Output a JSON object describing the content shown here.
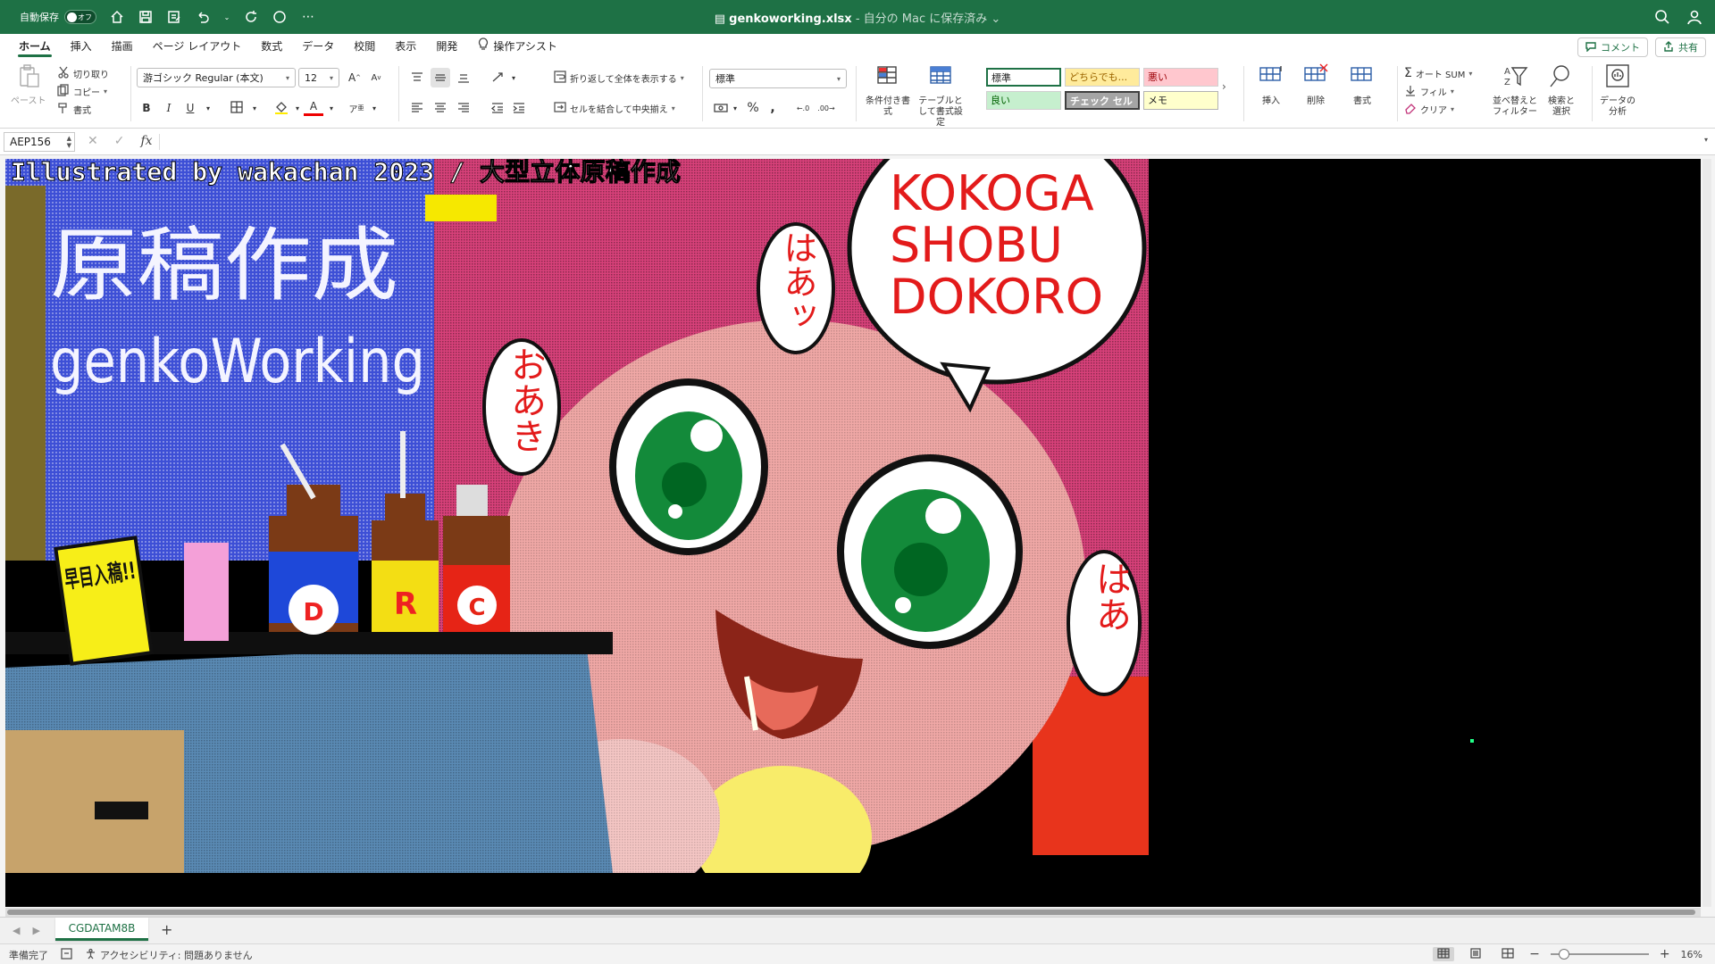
{
  "titlebar": {
    "autosave_label": "自動保存",
    "autosave_state": "オフ",
    "filename": "genkoworking.xlsx",
    "location": "- 自分の Mac に保存済み",
    "bg_color": "#1e7145"
  },
  "tabs": [
    {
      "label": "ホーム",
      "active": true
    },
    {
      "label": "挿入"
    },
    {
      "label": "描画"
    },
    {
      "label": "ページ レイアウト"
    },
    {
      "label": "数式"
    },
    {
      "label": "データ"
    },
    {
      "label": "校閲"
    },
    {
      "label": "表示"
    },
    {
      "label": "開発"
    },
    {
      "label": "操作アシスト"
    }
  ],
  "share": {
    "comment_label": "コメント",
    "share_label": "共有"
  },
  "clipboard": {
    "paste_label": "ペースト",
    "cut_label": "切り取り",
    "copy_label": "コピー",
    "format_label": "書式"
  },
  "font": {
    "family": "游ゴシック Regular (本文)",
    "size": "12"
  },
  "alignment": {
    "wrap_label": "折り返して全体を表示する",
    "merge_label": "セルを結合して中央揃え"
  },
  "number": {
    "format": "標準"
  },
  "styles": {
    "conditional_label": "条件付き書式",
    "table_label": "テーブルとして書式設定",
    "cells": [
      {
        "label": "標準",
        "bg": "#ffffff",
        "fg": "#222222"
      },
      {
        "label": "どちらでも...",
        "bg": "#ffeb9c",
        "fg": "#9c6500"
      },
      {
        "label": "悪い",
        "bg": "#ffc7ce",
        "fg": "#9c0006"
      },
      {
        "label": "良い",
        "bg": "#c6efce",
        "fg": "#006100"
      },
      {
        "label": "チェック セル",
        "bg": "#a5a5a5",
        "fg": "#ffffff"
      },
      {
        "label": "メモ",
        "bg": "#ffffcc",
        "fg": "#222222"
      }
    ]
  },
  "cells": {
    "insert_label": "挿入",
    "delete_label": "削除",
    "format_label": "書式"
  },
  "editing": {
    "autosum_label": "オート SUM",
    "fill_label": "フィル",
    "clear_label": "クリア",
    "sort_label": "並べ替えとフィルター",
    "find_label": "検索と選択"
  },
  "analysis": {
    "label": "データの分析"
  },
  "formula_bar": {
    "name_box": "AEP156",
    "fx": "fx",
    "cancel": "✕",
    "enter": "✓"
  },
  "artwork": {
    "credit": "Illustrated by wakachan 2023 / 大型立体原稿作成",
    "title_jp": "原稿作成",
    "title_en": "genkoWorking",
    "speech": "KOKOGA SHOBU DOKORO",
    "sfx_left": "おあき",
    "sfx_top": "はあッ",
    "sfx_right": "はあ",
    "sign": "早目入稿!!",
    "bottle_labels": [
      "D",
      "R",
      "C"
    ]
  },
  "sheet": {
    "tab_label": "CGDATAM8B",
    "add_label": "+"
  },
  "status": {
    "ready": "準備完了",
    "accessibility": "アクセシビリティ: 問題ありません",
    "zoom": "16%",
    "zoom_fraction": 0.16
  }
}
